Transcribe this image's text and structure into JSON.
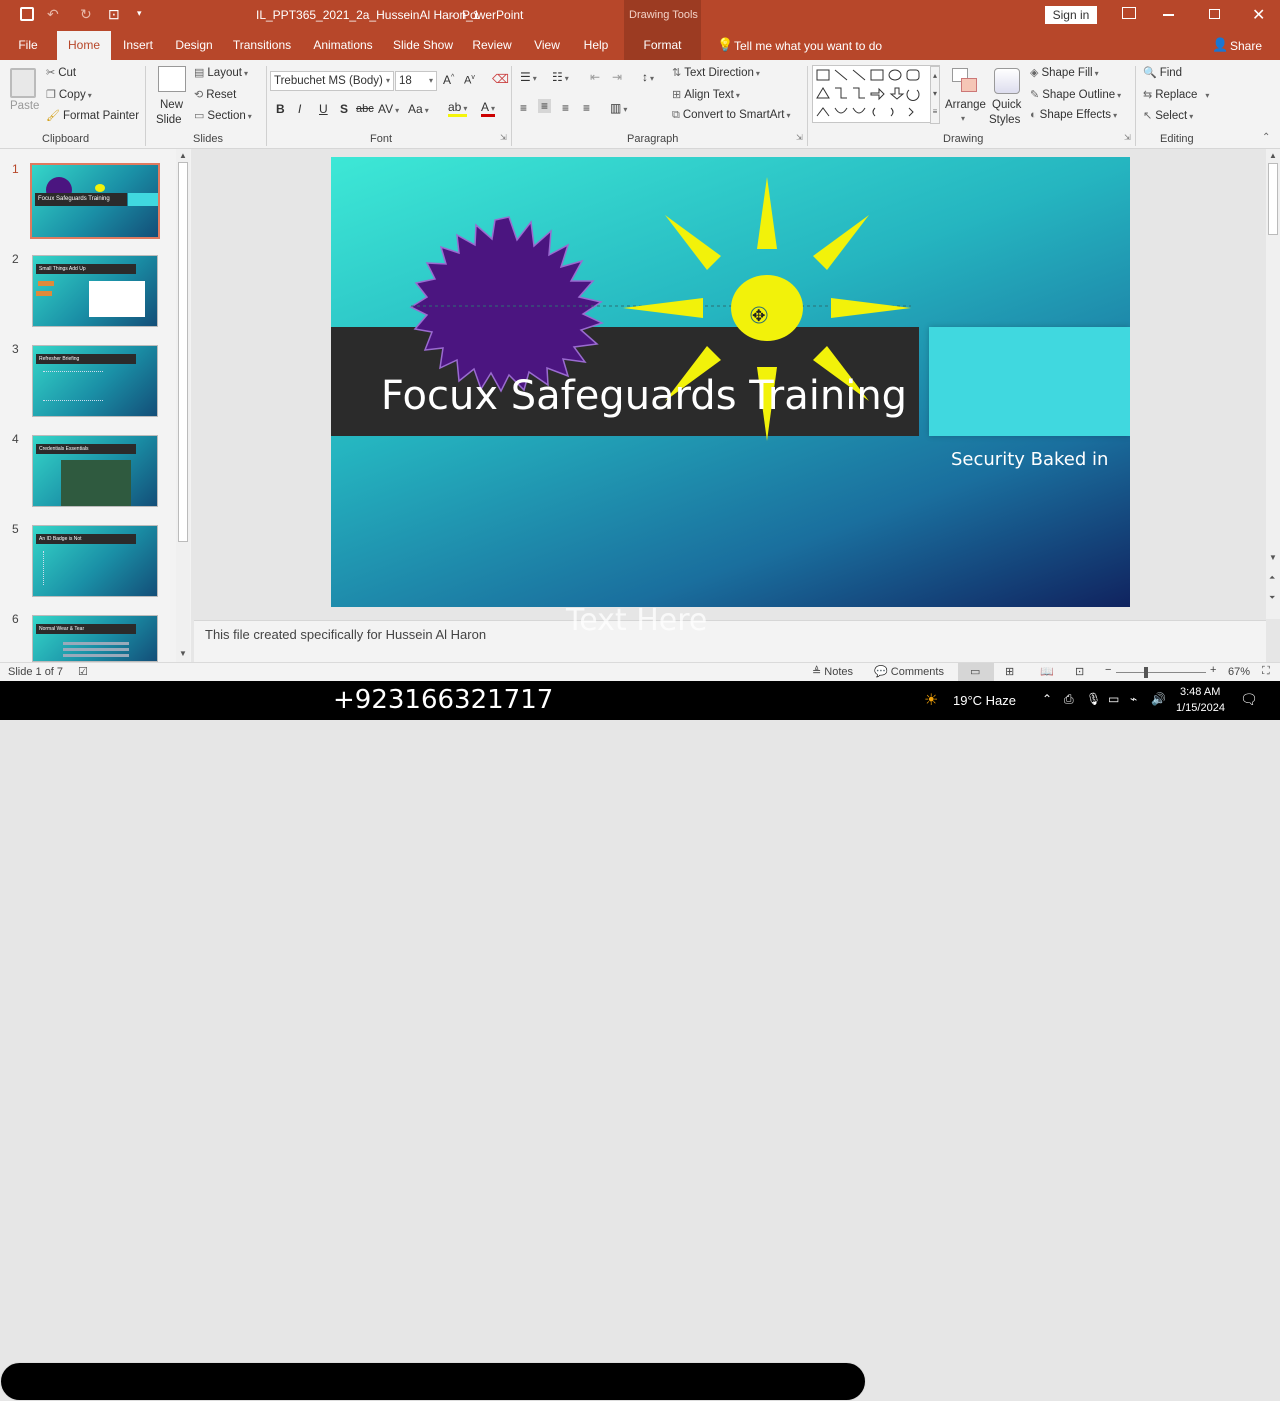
{
  "titlebar": {
    "doc_title": "IL_PPT365_2021_2a_HusseinAl Haron_1",
    "separator": "-",
    "app_name": "PowerPoint",
    "context_group": "Drawing Tools",
    "sign_in": "Sign in"
  },
  "menu": {
    "tabs": [
      "File",
      "Home",
      "Insert",
      "Design",
      "Transitions",
      "Animations",
      "Slide Show",
      "Review",
      "View",
      "Help",
      "Format"
    ],
    "tell_me": "Tell me what you want to do",
    "share": "Share"
  },
  "ribbon": {
    "clipboard": {
      "label": "Clipboard",
      "paste": "Paste",
      "cut": "Cut",
      "copy": "Copy",
      "format_painter": "Format Painter"
    },
    "slides": {
      "label": "Slides",
      "new_slide_1": "New",
      "new_slide_2": "Slide",
      "layout": "Layout",
      "reset": "Reset",
      "section": "Section"
    },
    "font": {
      "label": "Font",
      "family": "Trebuchet MS (Body)",
      "size": "18"
    },
    "paragraph": {
      "label": "Paragraph",
      "text_direction": "Text Direction",
      "align_text": "Align Text",
      "convert_smartart": "Convert to SmartArt"
    },
    "drawing": {
      "label": "Drawing",
      "arrange": "Arrange",
      "quick_1": "Quick",
      "quick_2": "Styles",
      "shape_fill": "Shape Fill",
      "shape_outline": "Shape Outline",
      "shape_effects": "Shape Effects"
    },
    "editing": {
      "label": "Editing",
      "find": "Find",
      "replace": "Replace",
      "select": "Select"
    }
  },
  "slides_panel": {
    "numbers": [
      "1",
      "2",
      "3",
      "4",
      "5",
      "6"
    ],
    "titles": [
      "Focux Safeguards Training",
      "Small Things Add Up",
      "Refresher Briefing",
      "Credentials Essentials",
      "An ID Badge is Not",
      "Normal Wear & Tear"
    ]
  },
  "slide": {
    "title": "Focux Safeguards Training",
    "subtitle": "Security Baked in",
    "overlay_text": "Text Here"
  },
  "notes": {
    "text": "This file created specifically for Hussein Al Haron"
  },
  "status": {
    "slide_counter": "Slide 1 of 7",
    "notes_btn": "Notes",
    "comments_btn": "Comments",
    "zoom": "67%"
  },
  "taskbar": {
    "phone": "+923166321717",
    "weather": "19°C  Haze",
    "time": "3:48 AM",
    "date": "1/15/2024"
  },
  "colors": {
    "accent": "#b7472a",
    "slide_band": "#2b2b2b",
    "sun": "#f2f20a",
    "starburst": "#4b1580",
    "cyan_box": "#40d8df"
  }
}
